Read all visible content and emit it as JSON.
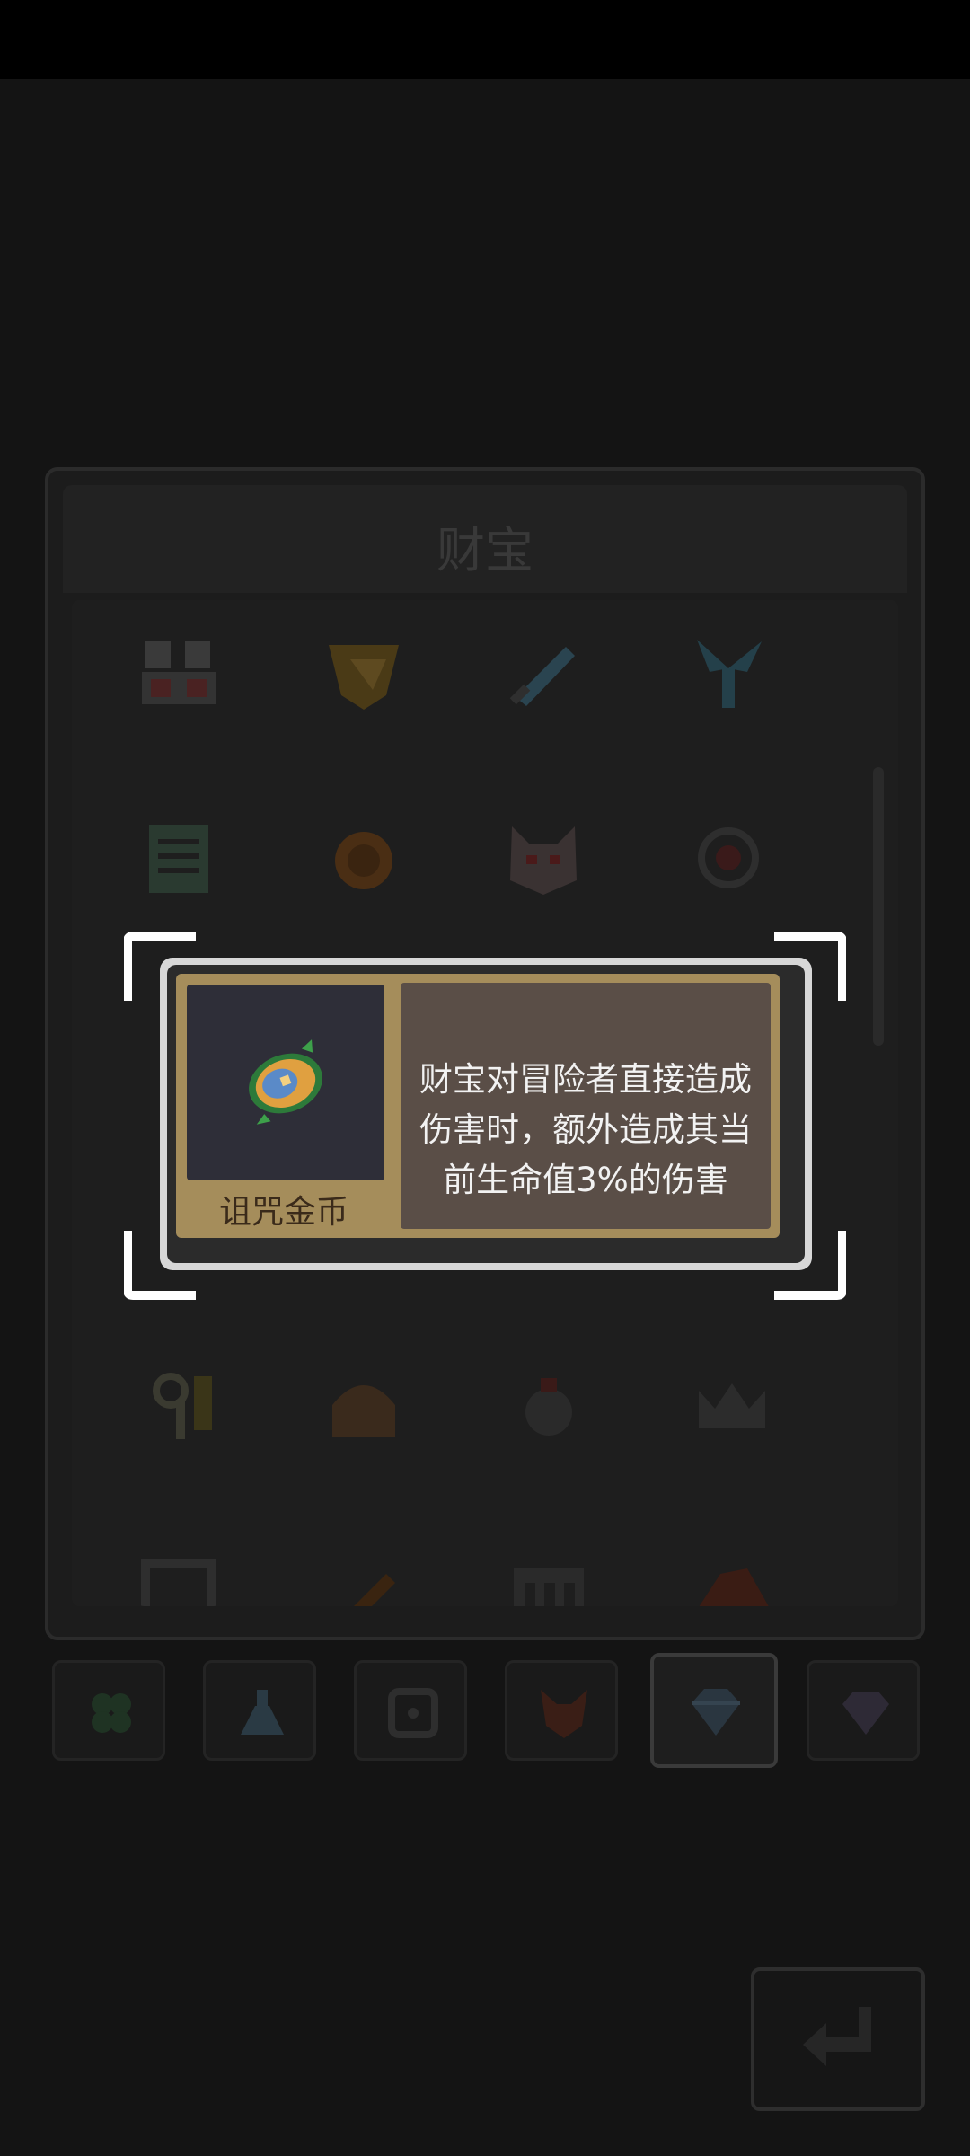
{
  "panel": {
    "title": "财宝"
  },
  "tooltip": {
    "item_name": "诅咒金币",
    "description": "财宝对冒险者直接造成伤害时，额外造成其当前生命值3%的伤害"
  },
  "grid_items": [
    {
      "icon": "chest-icon"
    },
    {
      "icon": "golden-shield-icon"
    },
    {
      "icon": "sword-icon"
    },
    {
      "icon": "windmill-icon"
    },
    {
      "icon": "scroll-icon"
    },
    {
      "icon": "orange-orb-icon"
    },
    {
      "icon": "demon-mask-icon"
    },
    {
      "icon": "target-ring-icon"
    },
    {
      "icon": "key-icon"
    },
    {
      "icon": "helmet-icon"
    },
    {
      "icon": "potion-bag-icon"
    },
    {
      "icon": "crown-icon"
    },
    {
      "icon": "frame-icon"
    },
    {
      "icon": "wand-icon"
    },
    {
      "icon": "gate-icon"
    },
    {
      "icon": "hat-icon"
    }
  ],
  "tabs": [
    {
      "icon": "clover-icon",
      "active": false
    },
    {
      "icon": "flask-icon",
      "active": false
    },
    {
      "icon": "dice-icon",
      "active": false
    },
    {
      "icon": "fox-icon",
      "active": false
    },
    {
      "icon": "blue-diamond-icon",
      "active": true
    },
    {
      "icon": "purple-diamond-icon",
      "active": false
    }
  ],
  "colors": {
    "card_gold": "#a58d5b",
    "desc_bg": "#5a4e47",
    "frame_white": "#ffffff"
  }
}
